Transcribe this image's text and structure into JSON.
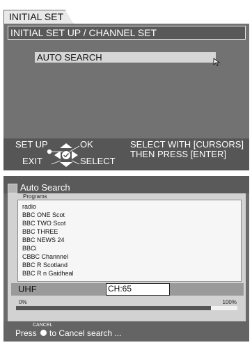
{
  "setup": {
    "tab_label": "INITIAL SET UP",
    "title": "INITIAL SET UP / CHANNEL SET",
    "menu_item": "AUTO SEARCH",
    "nav": {
      "setup": "SET UP",
      "ok": "OK",
      "exit": "EXIT",
      "select": "SELECT",
      "hint_line1": "SELECT WITH [CURSORS]",
      "hint_line2": "THEN PRESS [ENTER]"
    }
  },
  "autosearch": {
    "title": "Auto Search",
    "programs_label": "Programs",
    "programs": [
      "radio",
      "BBC ONE Scot",
      "BBC TWO Scot",
      "BBC THREE",
      "BBC NEWS 24",
      "BBCi",
      "CBBC Channnel",
      "BBC R Scotland",
      "BBC R n Gaidheal"
    ],
    "band": "UHF",
    "channel": "CH:65",
    "pct_start": "0%",
    "pct_end": "100%",
    "progress": 0.88,
    "cancel_label": "CANCEL",
    "press_text": "Press",
    "cancel_text": "to Cancel search ..."
  },
  "icons": [
    "cursor-arrow-icon",
    "dpad-icon",
    "window-icon",
    "button-dot-icon"
  ]
}
